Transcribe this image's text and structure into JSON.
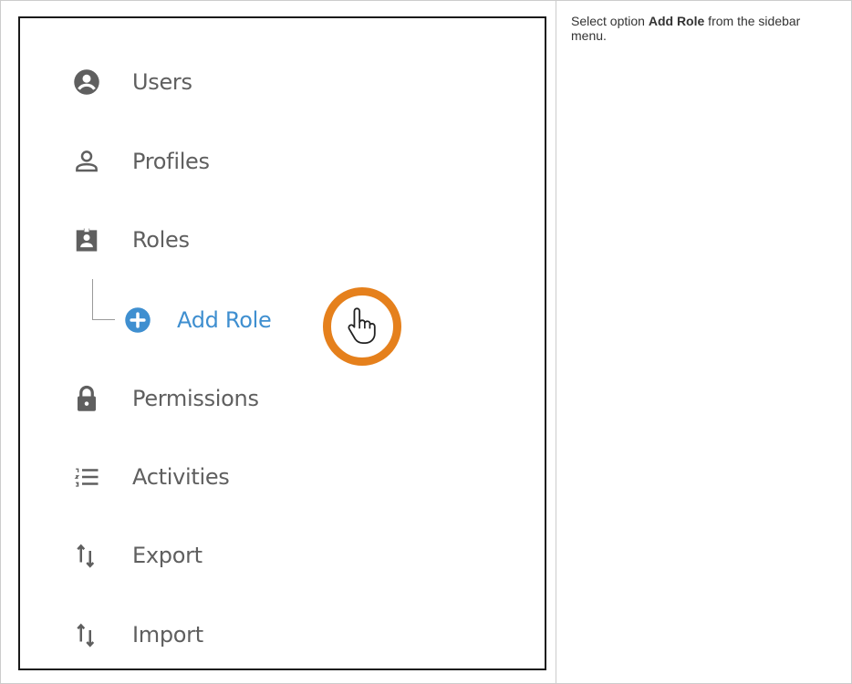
{
  "sidebar": {
    "items": [
      {
        "label": "Users",
        "icon": "account-circle-icon"
      },
      {
        "label": "Profiles",
        "icon": "person-outline-icon"
      },
      {
        "label": "Roles",
        "icon": "badge-clipboard-icon"
      },
      {
        "label": "Add Role",
        "icon": "add-circle-icon"
      },
      {
        "label": "Permissions",
        "icon": "lock-icon"
      },
      {
        "label": "Activities",
        "icon": "format-list-numbered-icon"
      },
      {
        "label": "Export",
        "icon": "import-export-icon"
      },
      {
        "label": "Import",
        "icon": "import-export-icon"
      }
    ]
  },
  "instruction": {
    "prefix": "Select option ",
    "emphasis": "Add Role",
    "suffix": " from the sidebar menu."
  },
  "colors": {
    "text_gray": "#5f5f5f",
    "active_blue": "#3f8fd0",
    "highlight_orange": "#e5801c",
    "frame": "#1a1a1a"
  }
}
